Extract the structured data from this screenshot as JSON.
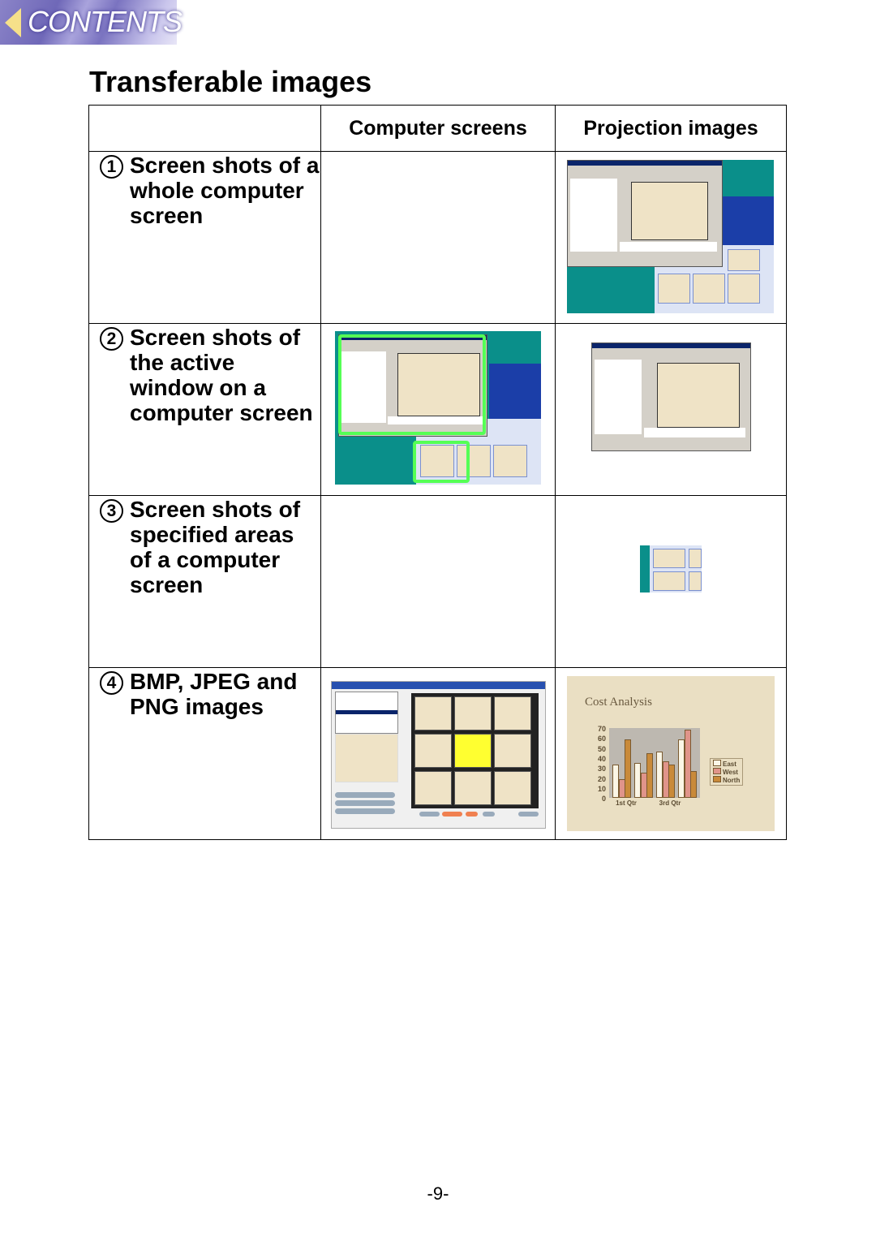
{
  "nav": {
    "contents_label": "CONTENTS"
  },
  "title": "Transferable images",
  "table": {
    "headers": [
      "",
      "Computer screens",
      "Projection images"
    ],
    "rows": [
      {
        "num": "1",
        "label": "Screen shots of a whole computer screen"
      },
      {
        "num": "2",
        "label": "Screen shots of the active window on a computer screen"
      },
      {
        "num": "3",
        "label": "Screen shots of specified areas of a computer screen"
      },
      {
        "num": "4",
        "label": "BMP, JPEG and PNG images"
      }
    ]
  },
  "sample_slide": {
    "title": "Cost Analysis",
    "yticks": [
      "70",
      "60",
      "50",
      "40",
      "30",
      "20",
      "10",
      "0"
    ],
    "xlabels": [
      "1st Qtr",
      "3rd Qtr"
    ],
    "legend": [
      "East",
      "West",
      "North"
    ],
    "series_colors": {
      "East": "#fbf6e6",
      "West": "#e0948a",
      "North": "#c98a3a"
    },
    "values": {
      "East": [
        32,
        33,
        45,
        57
      ],
      "West": [
        17,
        24,
        35,
        67
      ],
      "North": [
        57,
        43,
        32,
        25
      ]
    }
  },
  "highlight_color": "#55ff55",
  "page_number": "-9-"
}
